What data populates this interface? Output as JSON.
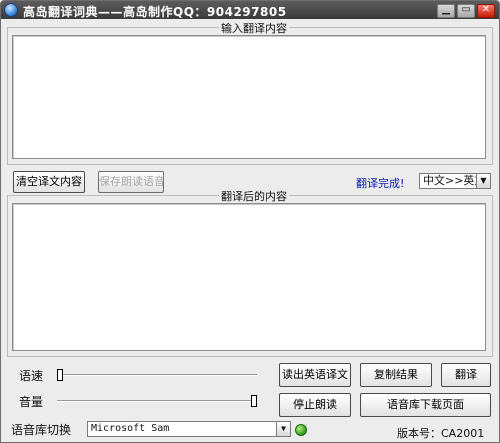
{
  "window": {
    "title": "高岛翻译词典——高岛制作QQ：904297805",
    "controls": [
      "minimize-icon",
      "restore-icon",
      "close-icon"
    ]
  },
  "input_section": {
    "label": "输入翻译内容",
    "value": ""
  },
  "toolbar": {
    "clear_button": "清空译文内容",
    "save_button": "保存朗读语音",
    "status": "翻译完成!",
    "direction_select": "中文>>英文"
  },
  "output_section": {
    "label": "翻译后的内容",
    "value": ""
  },
  "controls": {
    "speed_label": "语速",
    "speed_level": 0.0,
    "volume_label": "音量",
    "volume_level": 1.0,
    "voice_label": "语音库切换",
    "voice_select": "Microsoft Sam"
  },
  "buttons": {
    "read_english": "读出英语译文",
    "copy_result": "复制结果",
    "translate": "翻译",
    "stop_reading": "停止朗读",
    "voice_download": "语音库下载页面"
  },
  "version": "版本号：CA2001",
  "colors": {
    "status_text": "#0a1aa8",
    "title_bar": "#444444"
  }
}
